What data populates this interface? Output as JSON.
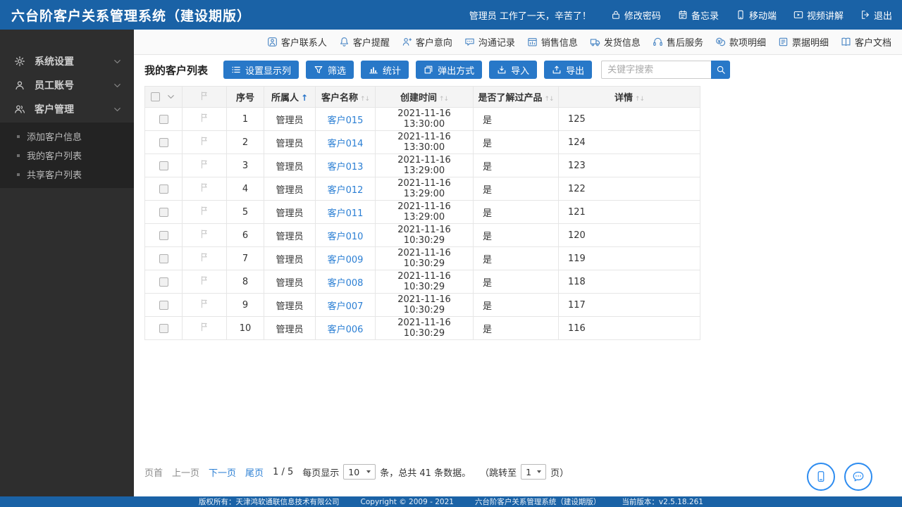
{
  "header": {
    "title": "六台阶客户关系管理系统（建设期版）",
    "greeting": "管理员 工作了一天，辛苦了！",
    "menu": [
      {
        "label": "修改密码",
        "icon": "lock-icon"
      },
      {
        "label": "备忘录",
        "icon": "memo-icon"
      },
      {
        "label": "移动端",
        "icon": "mobile-icon"
      },
      {
        "label": "视频讲解",
        "icon": "video-icon"
      },
      {
        "label": "退出",
        "icon": "logout-icon"
      }
    ]
  },
  "quickbar": {
    "items": [
      {
        "label": "客户联系人",
        "icon": "contact-icon"
      },
      {
        "label": "客户提醒",
        "icon": "bell-icon"
      },
      {
        "label": "客户意向",
        "icon": "intent-icon"
      },
      {
        "label": "沟通记录",
        "icon": "chat-icon"
      },
      {
        "label": "销售信息",
        "icon": "sales-icon"
      },
      {
        "label": "发货信息",
        "icon": "truck-icon"
      },
      {
        "label": "售后服务",
        "icon": "service-icon"
      },
      {
        "label": "款项明细",
        "icon": "coins-icon"
      },
      {
        "label": "票据明细",
        "icon": "invoice-icon"
      },
      {
        "label": "客户文档",
        "icon": "document-icon"
      }
    ]
  },
  "sidebar": {
    "groups": [
      {
        "label": "系统设置",
        "icon": "gear-icon"
      },
      {
        "label": "员工账号",
        "icon": "user-icon"
      },
      {
        "label": "客户管理",
        "icon": "users-icon",
        "expanded": true
      }
    ],
    "submenu": [
      {
        "label": "添加客户信息"
      },
      {
        "label": "我的客户列表"
      },
      {
        "label": "共享客户列表"
      }
    ]
  },
  "content": {
    "title": "我的客户列表",
    "actions": [
      {
        "label": "设置显示列",
        "icon": "columns-icon"
      },
      {
        "label": "筛选",
        "icon": "funnel-icon"
      },
      {
        "label": "统计",
        "icon": "chart-icon"
      },
      {
        "label": "弹出方式",
        "icon": "popup-icon"
      },
      {
        "label": "导入",
        "icon": "import-icon"
      },
      {
        "label": "导出",
        "icon": "export-icon"
      }
    ],
    "search": {
      "placeholder": "关键字搜索"
    },
    "table": {
      "columns": [
        "序号",
        "所属人",
        "客户名称",
        "创建时间",
        "是否了解过产品",
        "详情"
      ],
      "sorted_column": "所属人",
      "sort_direction": "asc",
      "rows": [
        {
          "seq": "1",
          "owner": "管理员",
          "name": "客户015",
          "created": "2021-11-16 13:30:00",
          "known": "是",
          "detail": "125"
        },
        {
          "seq": "2",
          "owner": "管理员",
          "name": "客户014",
          "created": "2021-11-16 13:30:00",
          "known": "是",
          "detail": "124"
        },
        {
          "seq": "3",
          "owner": "管理员",
          "name": "客户013",
          "created": "2021-11-16 13:29:00",
          "known": "是",
          "detail": "123"
        },
        {
          "seq": "4",
          "owner": "管理员",
          "name": "客户012",
          "created": "2021-11-16 13:29:00",
          "known": "是",
          "detail": "122"
        },
        {
          "seq": "5",
          "owner": "管理员",
          "name": "客户011",
          "created": "2021-11-16 13:29:00",
          "known": "是",
          "detail": "121"
        },
        {
          "seq": "6",
          "owner": "管理员",
          "name": "客户010",
          "created": "2021-11-16 10:30:29",
          "known": "是",
          "detail": "120"
        },
        {
          "seq": "7",
          "owner": "管理员",
          "name": "客户009",
          "created": "2021-11-16 10:30:29",
          "known": "是",
          "detail": "119"
        },
        {
          "seq": "8",
          "owner": "管理员",
          "name": "客户008",
          "created": "2021-11-16 10:30:29",
          "known": "是",
          "detail": "118"
        },
        {
          "seq": "9",
          "owner": "管理员",
          "name": "客户007",
          "created": "2021-11-16 10:30:29",
          "known": "是",
          "detail": "117"
        },
        {
          "seq": "10",
          "owner": "管理员",
          "name": "客户006",
          "created": "2021-11-16 10:30:29",
          "known": "是",
          "detail": "116"
        }
      ]
    },
    "pagination": {
      "first": "页首",
      "prev": "上一页",
      "next": "下一页",
      "last": "尾页",
      "page_indicator": "1 / 5",
      "per_page_prefix": "每页显示",
      "per_page_value": "10",
      "per_page_suffix": "条，总共 41 条数据。",
      "jump_prefix": "（跳转至",
      "jump_value": "1",
      "jump_suffix": "页）"
    }
  },
  "footer": {
    "copyright_owner": "版权所有：天津鸿软通联信息技术有限公司",
    "copyright": "Copyright © 2009 - 2021",
    "system_name": "六台阶客户关系管理系统（建设期版）",
    "version": "当前版本：v2.5.18.261"
  },
  "colors": {
    "header_bg": "#1a62a6",
    "button_blue": "#2878c8",
    "link_blue": "#2b7fd4",
    "sidebar_bg": "#2e2e2e",
    "submenu_bg": "#232323"
  }
}
